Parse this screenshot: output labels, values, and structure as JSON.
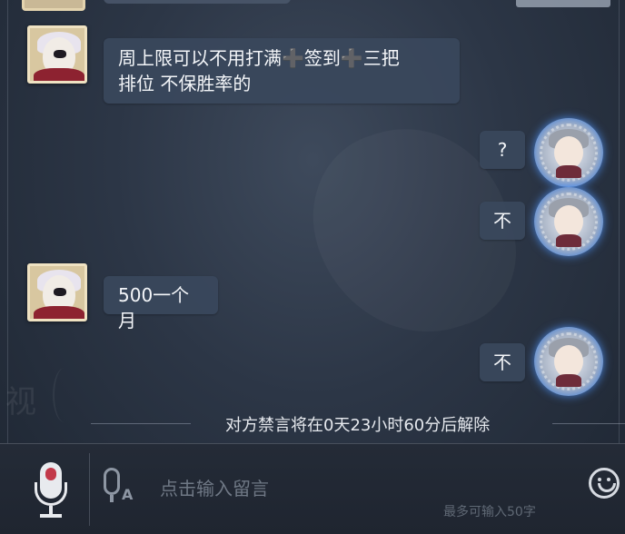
{
  "messages": [
    {
      "side": "left",
      "text_line1": "周上限可以不用打满➕签到➕三把",
      "text_line2": "排位  不保胜率的"
    },
    {
      "side": "right",
      "text": "?"
    },
    {
      "side": "right",
      "text": "不"
    },
    {
      "side": "left",
      "text": "500一个月"
    },
    {
      "side": "right",
      "text": "不"
    }
  ],
  "watermark_text": "视",
  "system_notice": "对方禁言将在0天23小时60分后解除",
  "input": {
    "placeholder": "点击输入留言",
    "value": "",
    "char_limit_hint": "最多可输入50字"
  },
  "icons": {
    "voice": "microphone-icon",
    "voice_to_text": "voice-to-text-icon",
    "emoji": "emoji-smile-icon"
  },
  "colors": {
    "bubble": "#3a485c",
    "background": "#2c3646",
    "mic_accent": "#c2394a"
  }
}
